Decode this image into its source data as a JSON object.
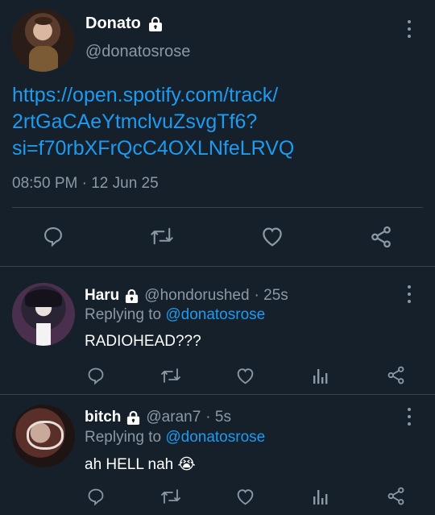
{
  "main_tweet": {
    "display_name": "Donato",
    "handle": "@donatosrose",
    "text_line1": "https://open.spotify.com/track/",
    "text_line2": "2rtGaCAeYtmclvuZsvgTf6?",
    "text_line3": "si=f70rbXFrQcC4OXLNfeLRVQ",
    "timestamp": "08:50 PM · 12 Jun 25"
  },
  "replies": [
    {
      "display_name": "Haru",
      "handle": "@hondorushed",
      "time": "· 25s",
      "replying_label": "Replying to",
      "replying_to": "@donatosrose",
      "text": "RADIOHEAD???"
    },
    {
      "display_name": "bitch",
      "handle": "@aran7",
      "time": "· 5s",
      "replying_label": "Replying to",
      "replying_to": "@donatosrose",
      "text": "ah HELL nah",
      "emoji": "😭"
    }
  ],
  "colors": {
    "background": "#15202b",
    "link": "#1d9bf0",
    "muted": "#8b98a5",
    "divider": "#38444d"
  },
  "icons": [
    "lock-icon",
    "more-icon",
    "reply-icon",
    "retweet-icon",
    "like-icon",
    "share-icon",
    "analytics-icon"
  ]
}
